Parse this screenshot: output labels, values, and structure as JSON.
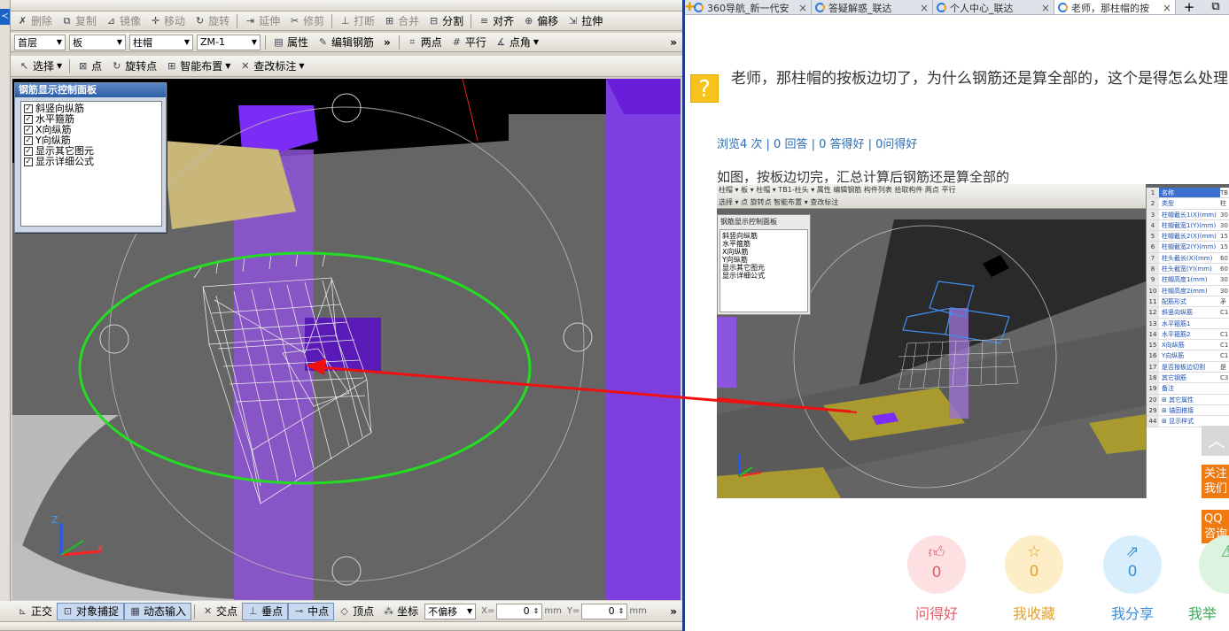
{
  "left_app": {
    "side_tag": "≺",
    "toolbar1": [
      {
        "label": "删除",
        "icon": "✗"
      },
      {
        "label": "复制",
        "icon": "⧉"
      },
      {
        "label": "镜像",
        "icon": "⊿"
      },
      {
        "label": "移动",
        "icon": "✛"
      },
      {
        "label": "旋转",
        "icon": "↻"
      },
      {
        "label": "延伸",
        "icon": "⇥"
      },
      {
        "label": "修剪",
        "icon": "✂"
      },
      {
        "label": "打断",
        "icon": "⊥"
      },
      {
        "label": "合并",
        "icon": "⊞"
      },
      {
        "label": "分割",
        "icon": "⊟"
      },
      {
        "label": "对齐",
        "icon": "≡"
      },
      {
        "label": "偏移",
        "icon": "⊕"
      },
      {
        "label": "拉伸",
        "icon": "⇲"
      }
    ],
    "toolbar2": {
      "floor": "首层",
      "type": "板",
      "member": "柱帽",
      "name": "ZM-1",
      "props_label": "属性",
      "edit_rebar_label": "编辑钢筋",
      "two_points": "两点",
      "parallel": "平行",
      "point_angle": "点角",
      "more": "»"
    },
    "toolbar3": {
      "select": "选择",
      "point": "点",
      "rotate_point": "旋转点",
      "smart_layout": "智能布置",
      "check_annot": "查改标注"
    },
    "panel": {
      "title": "钢筋显示控制面板",
      "items": [
        "斜竖向纵筋",
        "水平箍筋",
        "X向纵筋",
        "Y向纵筋",
        "显示其它图元",
        "显示详细公式"
      ]
    },
    "axes": {
      "z": "Z",
      "x": "X"
    },
    "statusbar": {
      "ortho": "正交",
      "snap": "对象捕捉",
      "dyn_input": "动态输入",
      "intersect": "交点",
      "perp": "垂点",
      "mid": "中点",
      "vertex": "顶点",
      "coord": "坐标",
      "offset_mode": "不偏移",
      "x_label": "X=",
      "x_value": "0",
      "y_label": "Y=",
      "y_value": "0",
      "unit": "mm",
      "more": "»"
    }
  },
  "browser": {
    "tabs": [
      {
        "title": "360导航_新一代安",
        "close": "×"
      },
      {
        "title": "答疑解惑_联达",
        "close": "×"
      },
      {
        "title": "个人中心_联达",
        "close": "×"
      },
      {
        "title": "老师，那柱帽的按",
        "close": "×"
      }
    ],
    "new_tab": "+"
  },
  "question": {
    "icon": "?",
    "title": "老师，那柱帽的按板边切了，为什么钢筋还是算全部的，这个是得怎么处理",
    "stats": "浏览4 次 | 0 回答 | 0 答得好 | 0问得好",
    "description": "如图，按板边切完，汇总计算后钢筋还是算全部的"
  },
  "embedded": {
    "toolbar_row1": "柱帽 ▾ 板 ▾ 柱帽 ▾ TB1-柱头 ▾ 属性 编辑钢筋 构件列表 拾取构件 两点 平行",
    "toolbar_row2": "选择 ▾ 点 旋转点 智能布置 ▾ 查改标注",
    "panel_title": "钢筋显示控制面板",
    "panel_items": [
      "斜竖向纵筋",
      "水平箍筋",
      "X向纵筋",
      "Y向纵筋",
      "显示其它图元",
      "显示详细公式"
    ],
    "table": [
      {
        "n": "1",
        "k": "名称",
        "v": "TB"
      },
      {
        "n": "2",
        "k": "类型",
        "v": "柱"
      },
      {
        "n": "3",
        "k": "柱帽截长1(X)(mm)",
        "v": "30"
      },
      {
        "n": "4",
        "k": "柱帽截宽1(Y)(mm)",
        "v": "30"
      },
      {
        "n": "5",
        "k": "柱帽截长2(X)(mm)",
        "v": "15"
      },
      {
        "n": "6",
        "k": "柱帽截宽2(Y)(mm)",
        "v": "15"
      },
      {
        "n": "7",
        "k": "柱头截长(X)(mm)",
        "v": "60"
      },
      {
        "n": "8",
        "k": "柱头截宽(Y)(mm)",
        "v": "60"
      },
      {
        "n": "9",
        "k": "柱帽高度1(mm)",
        "v": "30"
      },
      {
        "n": "10",
        "k": "柱帽高度2(mm)",
        "v": "30"
      },
      {
        "n": "11",
        "k": "配筋形式",
        "v": "矛"
      },
      {
        "n": "12",
        "k": "斜竖向纵筋",
        "v": "C1"
      },
      {
        "n": "13",
        "k": "水平箍筋1",
        "v": ""
      },
      {
        "n": "14",
        "k": "水平箍筋2",
        "v": "C1"
      },
      {
        "n": "15",
        "k": "X向纵筋",
        "v": "C1"
      },
      {
        "n": "16",
        "k": "Y向纵筋",
        "v": "C1"
      },
      {
        "n": "17",
        "k": "是否按板边切割",
        "v": "是"
      },
      {
        "n": "18",
        "k": "其它钢筋",
        "v": "C3"
      },
      {
        "n": "19",
        "k": "备注",
        "v": ""
      },
      {
        "n": "20",
        "k": "⊞ 其它属性",
        "v": ""
      },
      {
        "n": "29",
        "k": "⊞ 锚固搭接",
        "v": ""
      },
      {
        "n": "44",
        "k": "⊞ 显示样式",
        "v": ""
      }
    ]
  },
  "side_float": {
    "to_top": "︿",
    "follow": "关注我们",
    "qq": "QQ咨询"
  },
  "actions": [
    {
      "label": "问得好",
      "count": "0",
      "icon": "thumbs-up"
    },
    {
      "label": "我收藏",
      "count": "0",
      "icon": "star"
    },
    {
      "label": "我分享",
      "count": "0",
      "icon": "share"
    },
    {
      "label": "我举",
      "count": "",
      "icon": "report"
    }
  ],
  "colors": {
    "green_ellipse": "#22dd22",
    "red_arrow": "#ee1111",
    "purple": "#7b2cf5",
    "tan": "#c9b77a"
  }
}
